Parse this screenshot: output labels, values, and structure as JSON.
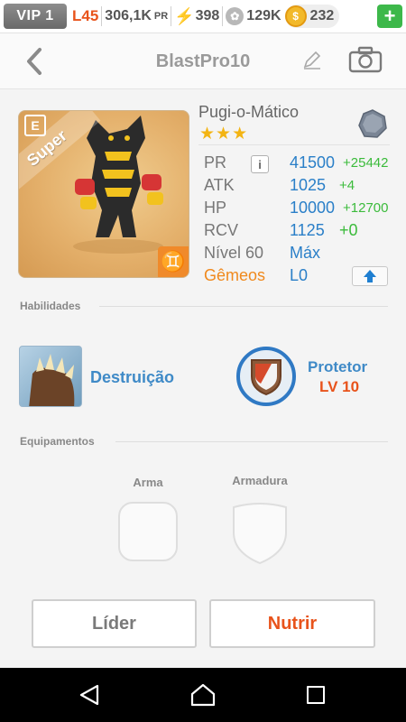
{
  "status_bar": {
    "vip": "VIP 1",
    "level": "L45",
    "power_value": "306,1K",
    "power_unit": "PR",
    "energy": "398",
    "paw_points": "129K",
    "coins": "232",
    "plus_label": "+"
  },
  "header": {
    "title": "BlastPro10"
  },
  "card": {
    "tag": "E",
    "rarity": "Super",
    "zodiac": "♊"
  },
  "monster": {
    "name": "Pugi-o-Mático",
    "stars": "★★★",
    "stars_count": 3
  },
  "stats": {
    "pr_label": "PR",
    "pr_value": "41500",
    "pr_bonus": "+25442",
    "info_label": "i",
    "atk_label": "ATK",
    "atk_value": "1025",
    "atk_bonus": "+4",
    "hp_label": "HP",
    "hp_value": "10000",
    "hp_bonus": "+12700",
    "rcv_label": "RCV",
    "rcv_value": "1125",
    "rcv_bonus": "+0",
    "level_label": "Nível 60",
    "level_value": "Máx",
    "twins_label": "Gêmeos",
    "twins_value": "L0"
  },
  "abilities": {
    "section_title": "Habilidades",
    "skill_name": "Destruição",
    "leader_name": "Protetor",
    "leader_level": "LV 10"
  },
  "equipment": {
    "section_title": "Equipamentos",
    "weapon_label": "Arma",
    "armor_label": "Armadura"
  },
  "buttons": {
    "leader": "Líder",
    "feed": "Nutrir"
  },
  "colors": {
    "accent_blue": "#2a7fc8",
    "accent_orange": "#e8531b",
    "bonus_green": "#3bbb3b",
    "star_gold": "#f3b413"
  },
  "icons": {
    "back": "chevron-left-icon",
    "edit": "pencil-icon",
    "camera": "camera-icon",
    "element": "stone-element-icon",
    "upgrade": "arrow-up-icon"
  }
}
